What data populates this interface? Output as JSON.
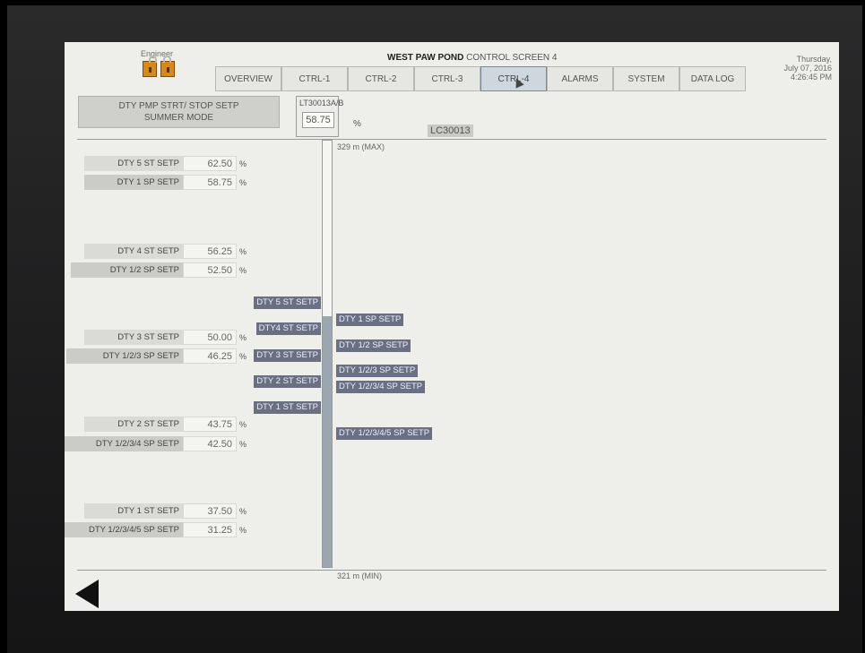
{
  "header": {
    "engineer_label": "Engineer",
    "title_bold": "WEST PAW POND",
    "title_rest": " CONTROL SCREEN 4",
    "day": "Thursday,",
    "date": "July 07, 2016",
    "time": "4:26:45 PM"
  },
  "tabs": [
    {
      "label": "OVERVIEW"
    },
    {
      "label": "CTRL-1"
    },
    {
      "label": "CTRL-2"
    },
    {
      "label": "CTRL-3"
    },
    {
      "label": "CTRL-4",
      "active": true
    },
    {
      "label": "ALARMS"
    },
    {
      "label": "SYSTEM"
    },
    {
      "label": "DATA LOG"
    }
  ],
  "mode": {
    "line1": "DTY PMP STRT/ STOP SETP",
    "line2": "SUMMER MODE"
  },
  "level": {
    "tag": "LT30013A/B",
    "value": "58.75",
    "unit": "%",
    "controller": "LC30013",
    "max_label": "329 m (MAX)",
    "min_label": "321 m (MIN)",
    "fill_fraction": 0.5875
  },
  "setpoints": [
    {
      "label": "DTY 5 ST SETP",
      "value": "62.50",
      "unit": "%"
    },
    {
      "label": "DTY 1 SP SETP",
      "value": "58.75",
      "unit": "%"
    },
    {
      "label": "DTY 4 ST SETP",
      "value": "56.25",
      "unit": "%"
    },
    {
      "label": "DTY 1/2 SP SETP",
      "value": "52.50",
      "unit": "%"
    },
    {
      "label": "DTY 3 ST SETP",
      "value": "50.00",
      "unit": "%"
    },
    {
      "label": "DTY 1/2/3 SP SETP",
      "value": "46.25",
      "unit": "%"
    },
    {
      "label": "DTY 2 ST SETP",
      "value": "43.75",
      "unit": "%"
    },
    {
      "label": "DTY 1/2/3/4 SP SETP",
      "value": "42.50",
      "unit": "%"
    },
    {
      "label": "DTY 1 ST SETP",
      "value": "37.50",
      "unit": "%"
    },
    {
      "label": "DTY 1/2/3/4/5 SP SETP",
      "value": "31.25",
      "unit": "%"
    }
  ],
  "start_markers": [
    "DTY 5 ST SETP",
    "DTY4 ST SETP",
    "DTY 3 ST SETP",
    "DTY 2 ST SETP",
    "DTY 1 ST SETP"
  ],
  "stop_markers": [
    "DTY 1 SP SETP",
    "DTY 1/2 SP SETP",
    "DTY 1/2/3 SP SETP",
    "DTY 1/2/3/4 SP SETP",
    "DTY 1/2/3/4/5 SP SETP"
  ],
  "colors": {
    "lock_accent": "#d98a16",
    "active_tab": "#cfd7de",
    "marker_bg": "#6a6f82",
    "bar_fill": "#9aa6b0"
  },
  "icons": {
    "unlock": "open-padlock-icon",
    "lock": "closed-padlock-icon",
    "back": "back-arrow-icon"
  }
}
